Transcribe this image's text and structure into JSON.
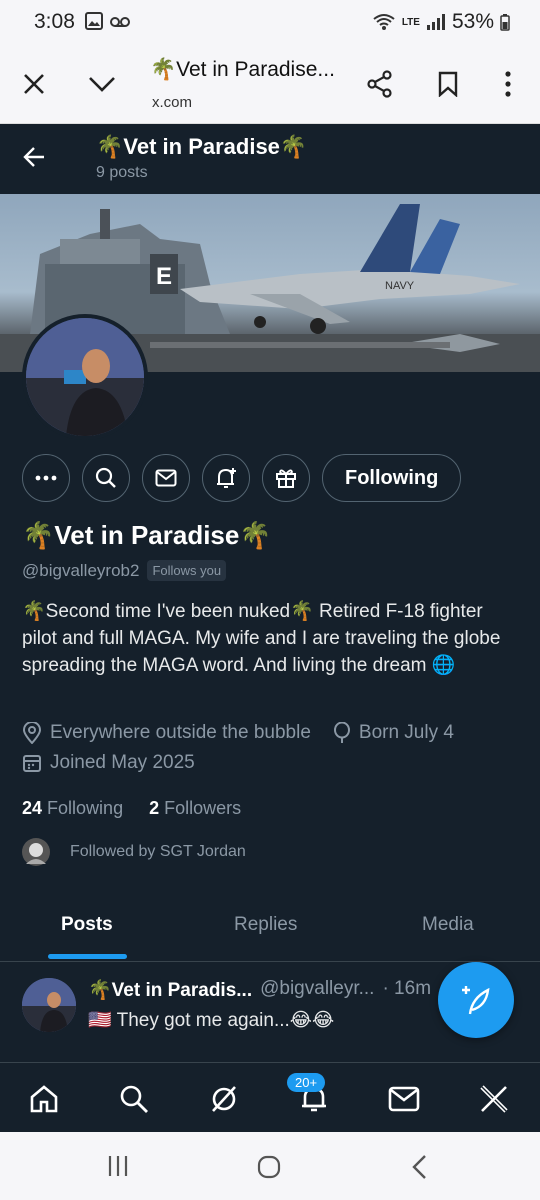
{
  "status": {
    "time": "3:08",
    "network": "LTE",
    "battery": "53%"
  },
  "browser": {
    "title": "🌴Vet in Paradise...",
    "domain": "x.com"
  },
  "profile": {
    "header_name": "🌴Vet in Paradise🌴",
    "post_count": "9 posts",
    "name": "🌴Vet in Paradise🌴",
    "handle": "@bigvalleyrob2",
    "follows_you": "Follows you",
    "following_button": "Following",
    "bio": "🌴Second time I've been nuked🌴 Retired F-18 fighter pilot and full MAGA. My wife and I are traveling the globe spreading the MAGA word. And living the dream 🌐",
    "location": "Everywhere outside the bubble",
    "birthday": "Born July 4",
    "joined": "Joined May 2025",
    "following_count": "24",
    "following_label": "Following",
    "followers_count": "2",
    "followers_label": "Followers",
    "followed_by": "Followed by SGT Jordan",
    "banner_text": {
      "island_letter": "E",
      "tail_text": "NAVY"
    }
  },
  "tabs": [
    "Posts",
    "Replies",
    "Media"
  ],
  "post": {
    "name": "🌴Vet in Paradis...",
    "handle": "@bigvalleyr...",
    "time": "· 16m",
    "text": "🇺🇸 They got me again...😂😂"
  },
  "nav": {
    "notifications_badge": "20+"
  },
  "colors": {
    "bg": "#15202b",
    "accent": "#1d9bf0",
    "muted": "#8b98a5"
  }
}
